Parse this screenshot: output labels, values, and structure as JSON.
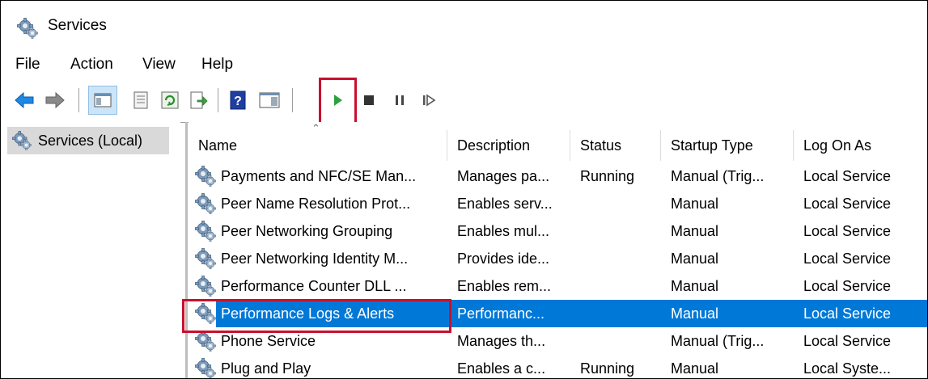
{
  "window": {
    "title": "Services"
  },
  "menu": [
    "File",
    "Action",
    "View",
    "Help"
  ],
  "toolbar": {
    "buttons": [
      "back-icon",
      "forward-icon",
      "show-hide-console-tree-icon",
      "properties-icon",
      "refresh-icon",
      "export-list-icon",
      "help-icon",
      "show-hide-action-pane-icon",
      "start-service-icon",
      "stop-service-icon",
      "pause-service-icon",
      "resume-service-icon"
    ]
  },
  "tree": {
    "item_label": "Services (Local)"
  },
  "table": {
    "columns": [
      "Name",
      "Description",
      "Status",
      "Startup Type",
      "Log On As"
    ],
    "rows": [
      {
        "name": "Payments and NFC/SE Man...",
        "description": "Manages pa...",
        "status": "Running",
        "startup": "Manual (Trig...",
        "logon": "Local Service"
      },
      {
        "name": "Peer Name Resolution Prot...",
        "description": "Enables serv...",
        "status": "",
        "startup": "Manual",
        "logon": "Local Service"
      },
      {
        "name": "Peer Networking Grouping",
        "description": "Enables mul...",
        "status": "",
        "startup": "Manual",
        "logon": "Local Service"
      },
      {
        "name": "Peer Networking Identity M...",
        "description": "Provides ide...",
        "status": "",
        "startup": "Manual",
        "logon": "Local Service"
      },
      {
        "name": "Performance Counter DLL ...",
        "description": "Enables rem...",
        "status": "",
        "startup": "Manual",
        "logon": "Local Service"
      },
      {
        "name": "Performance Logs & Alerts",
        "description": "Performanc...",
        "status": "",
        "startup": "Manual",
        "logon": "Local Service",
        "selected": true
      },
      {
        "name": "Phone Service",
        "description": "Manages th...",
        "status": "",
        "startup": "Manual (Trig...",
        "logon": "Local Service"
      },
      {
        "name": "Plug and Play",
        "description": "Enables a c...",
        "status": "Running",
        "startup": "Manual",
        "logon": "Local Syste..."
      }
    ]
  },
  "colors": {
    "selection": "#0078d7",
    "highlight_box": "#c8102e",
    "play_green": "#2ea043",
    "arrow_blue": "#1e88e5"
  }
}
